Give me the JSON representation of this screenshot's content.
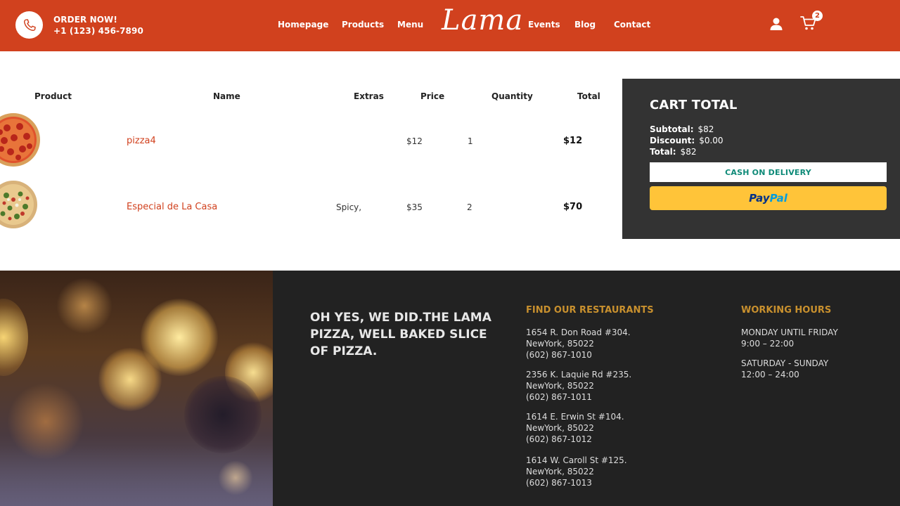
{
  "navbar": {
    "order_label": "ORDER NOW!",
    "phone": "+1 (123) 456-7890",
    "links_left": [
      "Homepage",
      "Products",
      "Menu"
    ],
    "logo": "Lama",
    "links_right": [
      "Events",
      "Blog",
      "Contact"
    ],
    "cart_count": "2",
    "icons": [
      "phone-icon",
      "user-icon",
      "cart-icon"
    ],
    "brand_color": "#d1411e"
  },
  "cart": {
    "headers": {
      "product": "Product",
      "name": "Name",
      "extras": "Extras",
      "price": "Price",
      "quantity": "Quantity",
      "total": "Total"
    },
    "rows": [
      {
        "name": "pizza4",
        "extras": "",
        "price": "$12",
        "quantity": "1",
        "total": "$12"
      },
      {
        "name": "Especial de La Casa",
        "extras": "Spicy,",
        "price": "$35",
        "quantity": "2",
        "total": "$70"
      }
    ]
  },
  "cart_total": {
    "title": "CART TOTAL",
    "subtotal_label": "Subtotal:",
    "subtotal_value": "$82",
    "discount_label": "Discount:",
    "discount_value": "$0.00",
    "total_label": "Total:",
    "total_value": "$82",
    "cod_button": "CASH ON DELIVERY",
    "paypal_part1": "Pay",
    "paypal_part2": "Pal"
  },
  "footer": {
    "motto": "OH YES, WE DID.THE LAMA PIZZA, WELL BAKED SLICE OF PIZZA.",
    "restaurants_title": "FIND OUR RESTAURANTS",
    "restaurants": [
      "1654 R. Don Road #304.\nNewYork, 85022\n(602) 867-1010",
      "2356 K. Laquie Rd #235.\nNewYork, 85022\n(602) 867-1011",
      "1614 E. Erwin St #104.\nNewYork, 85022\n(602) 867-1012",
      "1614 W. Caroll St #125.\nNewYork, 85022\n(602) 867-1013"
    ],
    "hours_title": "WORKING HOURS",
    "hours": [
      "MONDAY UNTIL FRIDAY\n9:00 – 22:00",
      "SATURDAY - SUNDAY\n12:00 – 24:00"
    ],
    "accent_color": "#c8902e"
  }
}
